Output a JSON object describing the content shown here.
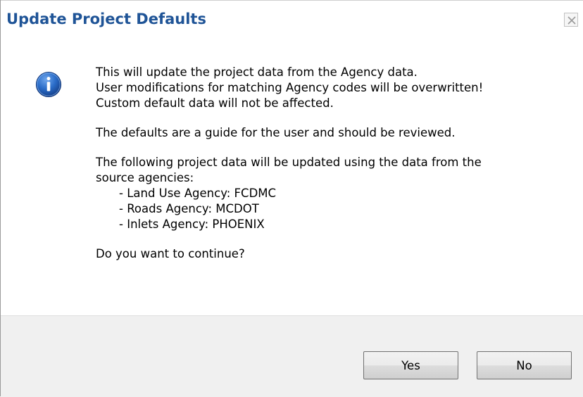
{
  "dialog": {
    "title": "Update Project Defaults",
    "close_icon": "close-icon",
    "info_icon": "info-icon",
    "message": {
      "para1": [
        "This will update the project data from the Agency data.",
        "User modifications for matching Agency codes will be overwritten!",
        "Custom default data will not be affected."
      ],
      "para2": "The defaults are a guide for the user and should be reviewed.",
      "para3_intro": [
        "The following project data will be updated using the data from the",
        "source agencies:"
      ],
      "items": [
        "- Land Use Agency: FCDMC",
        "- Roads Agency: MCDOT",
        "- Inlets Agency: PHOENIX"
      ],
      "question": "Do you want to continue?"
    },
    "buttons": {
      "yes_label": "Yes",
      "no_label": "No"
    },
    "colors": {
      "title_text": "#1f5497",
      "icon_blue": "#2060b8"
    }
  }
}
